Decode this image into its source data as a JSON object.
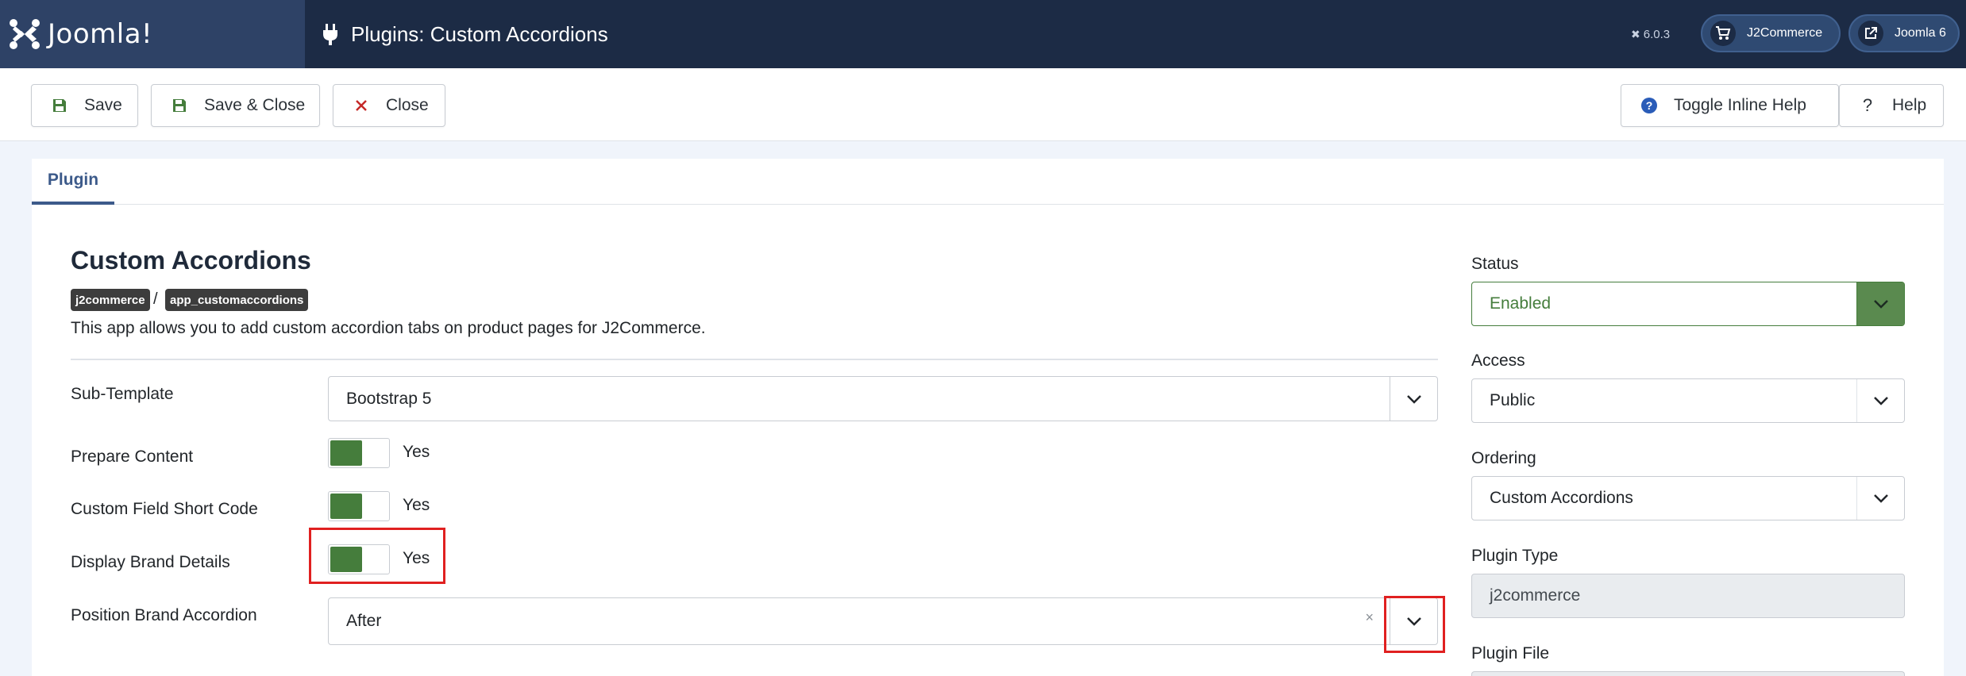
{
  "header": {
    "logo_text": "Joomla!",
    "page_title": "Plugins: Custom Accordions",
    "version": "6.0.3",
    "j2commerce_label": "J2Commerce",
    "site_label": "Joomla 6"
  },
  "toolbar": {
    "save_label": "Save",
    "save_close_label": "Save & Close",
    "close_label": "Close",
    "toggle_help_label": "Toggle Inline Help",
    "help_label": "Help"
  },
  "tabs": [
    {
      "label": "Plugin",
      "active": true
    }
  ],
  "plugin": {
    "title": "Custom Accordions",
    "folder_badge": "j2commerce",
    "element_badge": "app_customaccordions",
    "description": "This app allows you to add custom accordion tabs on product pages for J2Commerce."
  },
  "fields": {
    "sub_template": {
      "label": "Sub-Template",
      "value": "Bootstrap 5"
    },
    "prepare_content": {
      "label": "Prepare Content",
      "value": "Yes"
    },
    "custom_field_short_code": {
      "label": "Custom Field Short Code",
      "value": "Yes"
    },
    "display_brand_details": {
      "label": "Display Brand Details",
      "value": "Yes"
    },
    "position_brand_accordion": {
      "label": "Position Brand Accordion",
      "value": "After",
      "clear": "×"
    }
  },
  "sidebar": {
    "status": {
      "label": "Status",
      "value": "Enabled"
    },
    "access": {
      "label": "Access",
      "value": "Public"
    },
    "ordering": {
      "label": "Ordering",
      "value": "Custom Accordions"
    },
    "plugin_type": {
      "label": "Plugin Type",
      "value": "j2commerce"
    },
    "plugin_file": {
      "label": "Plugin File"
    }
  },
  "colors": {
    "header_bg": "#1c2b45",
    "accent_green": "#457d3c",
    "highlight_red": "#e02020",
    "tab_blue": "#3c5a8a"
  },
  "icons": {
    "logo": "joomla-logo-icon",
    "plugin": "plug-icon",
    "cart": "cart-icon",
    "external": "external-link-icon",
    "save": "floppy-disk-icon",
    "close": "x-icon",
    "help": "question-circle-icon",
    "chevron": "chevron-down-icon"
  }
}
